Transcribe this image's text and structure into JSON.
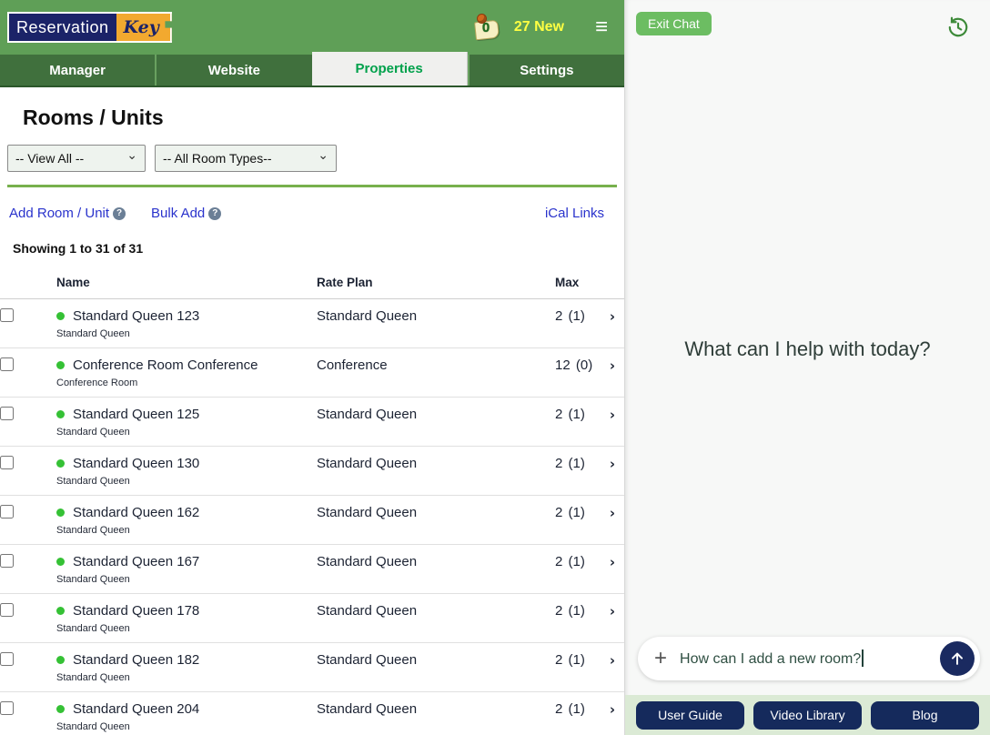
{
  "app": {
    "logo": {
      "part1": "Reservation",
      "part2": "Key"
    },
    "header": {
      "note_count": "0",
      "new_badge": "27 New"
    },
    "tabs": [
      {
        "label": "Manager"
      },
      {
        "label": "Website"
      },
      {
        "label": "Properties"
      },
      {
        "label": "Settings"
      }
    ]
  },
  "page": {
    "title": "Rooms / Units",
    "filters": {
      "view": "-- View All --",
      "room_type": "-- All Room Types--"
    },
    "links": {
      "add_room": "Add Room / Unit",
      "bulk_add": "Bulk Add",
      "ical": "iCal Links"
    },
    "showing": "Showing 1 to 31 of 31",
    "table": {
      "headers": {
        "name": "Name",
        "rate_plan": "Rate Plan",
        "max": "Max"
      },
      "rows": [
        {
          "name": "Standard Queen 123",
          "subtitle": "Standard Queen",
          "rate_plan": "Standard Queen",
          "max": "2 (1)"
        },
        {
          "name": "Conference Room Conference",
          "subtitle": "Conference Room",
          "rate_plan": "Conference",
          "max": "12 (0)"
        },
        {
          "name": "Standard Queen 125",
          "subtitle": "Standard Queen",
          "rate_plan": "Standard Queen",
          "max": "2 (1)"
        },
        {
          "name": "Standard Queen 130",
          "subtitle": "Standard Queen",
          "rate_plan": "Standard Queen",
          "max": "2 (1)"
        },
        {
          "name": "Standard Queen 162",
          "subtitle": "Standard Queen",
          "rate_plan": "Standard Queen",
          "max": "2 (1)"
        },
        {
          "name": "Standard Queen 167",
          "subtitle": "Standard Queen",
          "rate_plan": "Standard Queen",
          "max": "2 (1)"
        },
        {
          "name": "Standard Queen 178",
          "subtitle": "Standard Queen",
          "rate_plan": "Standard Queen",
          "max": "2 (1)"
        },
        {
          "name": "Standard Queen 182",
          "subtitle": "Standard Queen",
          "rate_plan": "Standard Queen",
          "max": "2 (1)"
        },
        {
          "name": "Standard Queen 204",
          "subtitle": "Standard Queen",
          "rate_plan": "Standard Queen",
          "max": "2 (1)"
        }
      ]
    }
  },
  "chat": {
    "exit_label": "Exit Chat",
    "greeting": "What can I help with today?",
    "input_value": "How can I add a new room?",
    "footer_buttons": [
      "User Guide",
      "Video Library",
      "Blog"
    ]
  },
  "colors": {
    "header_green": "#5f9f57",
    "tab_green": "#40703d",
    "active_tab_text": "#00a14b",
    "badge_yellow": "#ffff42",
    "link_blue": "#2a33cc",
    "status_dot_green": "#35c135",
    "navy": "#152a5c",
    "chat_button_green": "#6cbd62"
  }
}
